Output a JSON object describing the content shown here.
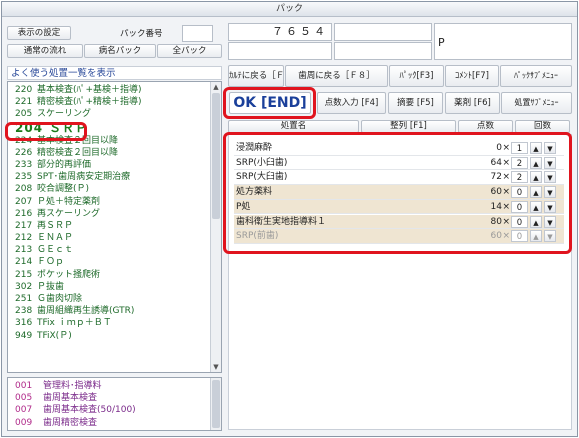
{
  "window": {
    "title": "パック"
  },
  "top_left": {
    "display_settings": "表示の設定",
    "pack_number_label": "パック番号",
    "normal_flow": "通常の流れ",
    "disease_pack": "病名パック",
    "all_pack": "全パック"
  },
  "header": {
    "number_display": "７６５４",
    "p_label": "P"
  },
  "toolbar": {
    "back_to_karte": "ｶﾙﾃに戻る［Ｆ９］",
    "back_to_tooth": "歯周に戻る［Ｆ８］",
    "pack_f3": "ﾊﾟｯｸ[F3]",
    "comment_f7": "ｺﾒﾝﾄ[F7]",
    "pack_submenu": "ﾊﾟｯｸｻﾌﾞﾒﾆｭｰ",
    "ok_end": "OK [END]",
    "points_input": "点数入力 [F4]",
    "summary": "摘要 [F5]",
    "medication": "薬剤 [F6]",
    "treatment_submenu": "処置ｻﾌﾞﾒﾆｭｰ"
  },
  "table_headers": {
    "name": "処置名",
    "sort": "整列 [F1]",
    "points": "点数",
    "count": "回数"
  },
  "section_label": "よく使う処置一覧を表示",
  "procedure_list": [
    {
      "code": "220",
      "name": "基本検査(ﾊﾟ+基検＋指導)"
    },
    {
      "code": "221",
      "name": "精密検査(ﾊﾟ+精検＋指導)"
    },
    {
      "code": "205",
      "name": "スケーリング"
    },
    {
      "code": "204",
      "name": "ＳＲＰ"
    },
    {
      "code": "224",
      "name": "基本検査２回目以降"
    },
    {
      "code": "226",
      "name": "精密検査２回目以降"
    },
    {
      "code": "233",
      "name": "部分的再評価"
    },
    {
      "code": "235",
      "name": "SPT･歯周病安定期治療"
    },
    {
      "code": "208",
      "name": "咬合調整(Ｐ)"
    },
    {
      "code": "207",
      "name": "Ｐ処＋特定薬剤"
    },
    {
      "code": "216",
      "name": "再スケーリング"
    },
    {
      "code": "217",
      "name": "再ＳＲＰ"
    },
    {
      "code": "212",
      "name": "ＥＮＡＰ"
    },
    {
      "code": "213",
      "name": "ＧＥｃｔ"
    },
    {
      "code": "214",
      "name": "ＦＯｐ"
    },
    {
      "code": "215",
      "name": "ポケット掻爬術"
    },
    {
      "code": "302",
      "name": "Ｐ抜歯"
    },
    {
      "code": "251",
      "name": "Ｇ歯肉切除"
    },
    {
      "code": "238",
      "name": "歯周組織再生誘導(GTR)"
    },
    {
      "code": "316",
      "name": "TFix ｉｍｐ＋ＢＴ"
    },
    {
      "code": "949",
      "name": "TFiX(Ｐ)"
    }
  ],
  "selected_code": "204",
  "lower_list": [
    {
      "code": "001",
      "name": "管理料･指導料"
    },
    {
      "code": "005",
      "name": "歯周基本検査"
    },
    {
      "code": "007",
      "name": "歯周基本検査(50/100)"
    },
    {
      "code": "009",
      "name": "歯周精密検査"
    }
  ],
  "table_rows": [
    {
      "name": "浸潤麻酔",
      "points": "0",
      "count": "1",
      "style": "plain"
    },
    {
      "name": "SRP(小臼歯)",
      "points": "64",
      "count": "2",
      "style": "plain"
    },
    {
      "name": "SRP(大臼歯)",
      "points": "72",
      "count": "2",
      "style": "plain"
    },
    {
      "name": "処方薬料",
      "points": "60",
      "count": "0",
      "style": "tan"
    },
    {
      "name": "P処",
      "points": "14",
      "count": "0",
      "style": "tan"
    },
    {
      "name": "歯科衛生実地指導料１",
      "points": "80",
      "count": "0",
      "style": "tan"
    },
    {
      "name": "SRP(前歯)",
      "points": "60",
      "count": "0",
      "style": "dim"
    }
  ],
  "symbols": {
    "times": "×",
    "up": "▲",
    "down": "▼"
  },
  "icons": {
    "scroll_up": "chevron-up-icon",
    "scroll_down": "chevron-down-icon"
  },
  "colors": {
    "highlight": "#e0141e",
    "ok_text": "#1a3f9a",
    "list_text": "#1e6a2a"
  }
}
